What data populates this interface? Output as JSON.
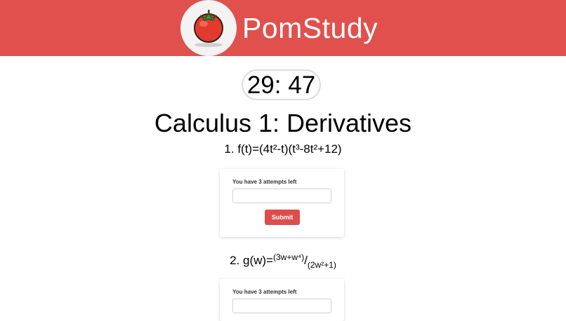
{
  "header": {
    "brand": "PomStudy",
    "logo_icon": "tomato-icon",
    "bg_color": "#e0504d"
  },
  "timer": {
    "value": "29: 47"
  },
  "page_title": "Calculus 1: Derivatives",
  "problems": [
    {
      "number": "1.",
      "expression": "f(t)=(4t²-t)(t³-8t²+12)",
      "attempts_text": "You have 3 attempts left",
      "answer_value": "",
      "submit_label": "Submit"
    },
    {
      "number": "2.",
      "prefix": "g(w)=",
      "numerator": "(3w+w⁴)",
      "slash": "/",
      "denominator": "(2w²+1)",
      "attempts_text": "You have 3 attempts left",
      "answer_value": ""
    }
  ],
  "colors": {
    "accent": "#dd4d4a",
    "header": "#e0504d"
  }
}
